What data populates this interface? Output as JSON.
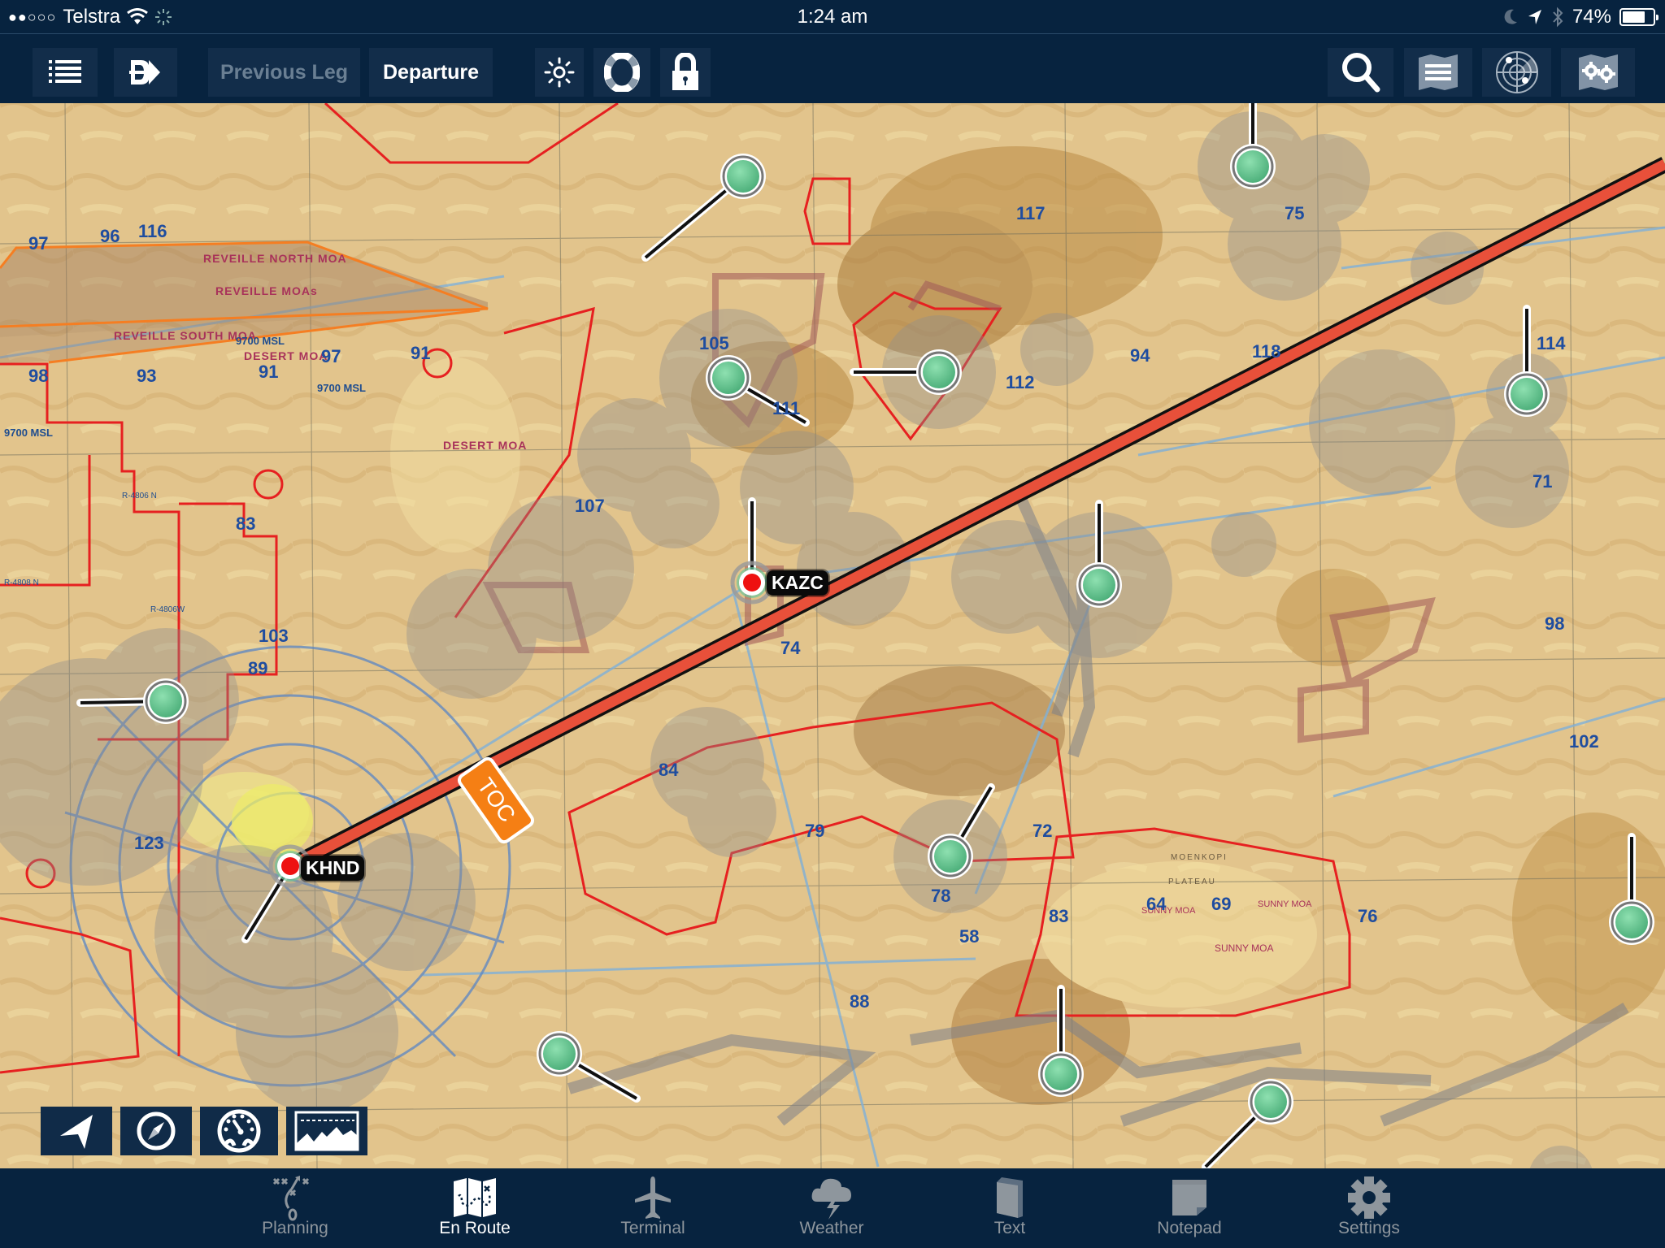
{
  "status_bar": {
    "signal_dots": "●●○○○",
    "carrier": "Telstra",
    "time": "1:24 am",
    "battery_percent": "74%",
    "battery_level": 0.74
  },
  "toolbar": {
    "previous_leg_label": "Previous Leg",
    "departure_label": "Departure",
    "left_icons": [
      "list-icon",
      "direct-to-icon"
    ],
    "center_icons": [
      "brightness-icon",
      "lifebuoy-icon",
      "lock-icon"
    ],
    "right_icons": [
      "search-icon",
      "map-layers-icon",
      "radar-icon",
      "map-settings-icon"
    ]
  },
  "map": {
    "route": {
      "color": "#e8503a",
      "waypoints": [
        {
          "id": "KHND",
          "label": "KHND"
        },
        {
          "id": "KAZC",
          "label": "KAZC"
        }
      ],
      "toc_label": "TOC"
    },
    "chart_labels": {
      "reveille_north": "REVEILLE NORTH MOA",
      "reveille_moas": "REVEILLE MOAs",
      "reveille_south": "REVEILLE SOUTH MOA",
      "desert_moa": "DESERT MOA",
      "desert_moa_2": "DESERT MOA",
      "sunny_moa_1": "SUNNY MOA",
      "sunny_moa_2": "SUNNY MOA",
      "sunny_moa_3": "SUNNY MOA",
      "msl_1": "9700 MSL",
      "msl_2": "9700 MSL",
      "msl_3": "9700 MSL",
      "plateau": "PLATEAU",
      "moenkopi": "MOENKOPI",
      "r4806n": "R-4806 N",
      "r4806w": "R-4806W",
      "r4808n": "R-4808 N",
      "mef": [
        "97",
        "116",
        "96",
        "98",
        "93",
        "91",
        "97",
        "91",
        "83",
        "89",
        "103",
        "123",
        "117",
        "105",
        "111",
        "118",
        "94",
        "112",
        "107",
        "114",
        "71",
        "74",
        "79",
        "84",
        "72",
        "78",
        "64",
        "69",
        "83",
        "76",
        "98",
        "102",
        "88",
        "75",
        "58"
      ]
    },
    "controls": [
      "track-up-icon",
      "compass-icon",
      "instruments-icon",
      "profile-view-icon"
    ]
  },
  "tab_bar": {
    "tabs": [
      {
        "id": "planning",
        "label": "Planning",
        "icon": "planning-icon",
        "active": false
      },
      {
        "id": "en-route",
        "label": "En Route",
        "icon": "map-icon",
        "active": true
      },
      {
        "id": "terminal",
        "label": "Terminal",
        "icon": "airplane-icon",
        "active": false
      },
      {
        "id": "weather",
        "label": "Weather",
        "icon": "storm-cloud-icon",
        "active": false
      },
      {
        "id": "text",
        "label": "Text",
        "icon": "book-icon",
        "active": false
      },
      {
        "id": "notepad",
        "label": "Notepad",
        "icon": "note-icon",
        "active": false
      },
      {
        "id": "settings",
        "label": "Settings",
        "icon": "gear-icon",
        "active": false
      }
    ]
  },
  "colors": {
    "chrome_bg": "#07233f",
    "button_bg": "#122d4a",
    "map_tan": "#e2c48c",
    "airspace_red": "#e62020",
    "moa_orange": "#f57e22",
    "station_green": "#5cc08a",
    "route_red": "#e8503a",
    "toc_orange": "#f57f14",
    "tab_inactive": "#8e969d"
  }
}
